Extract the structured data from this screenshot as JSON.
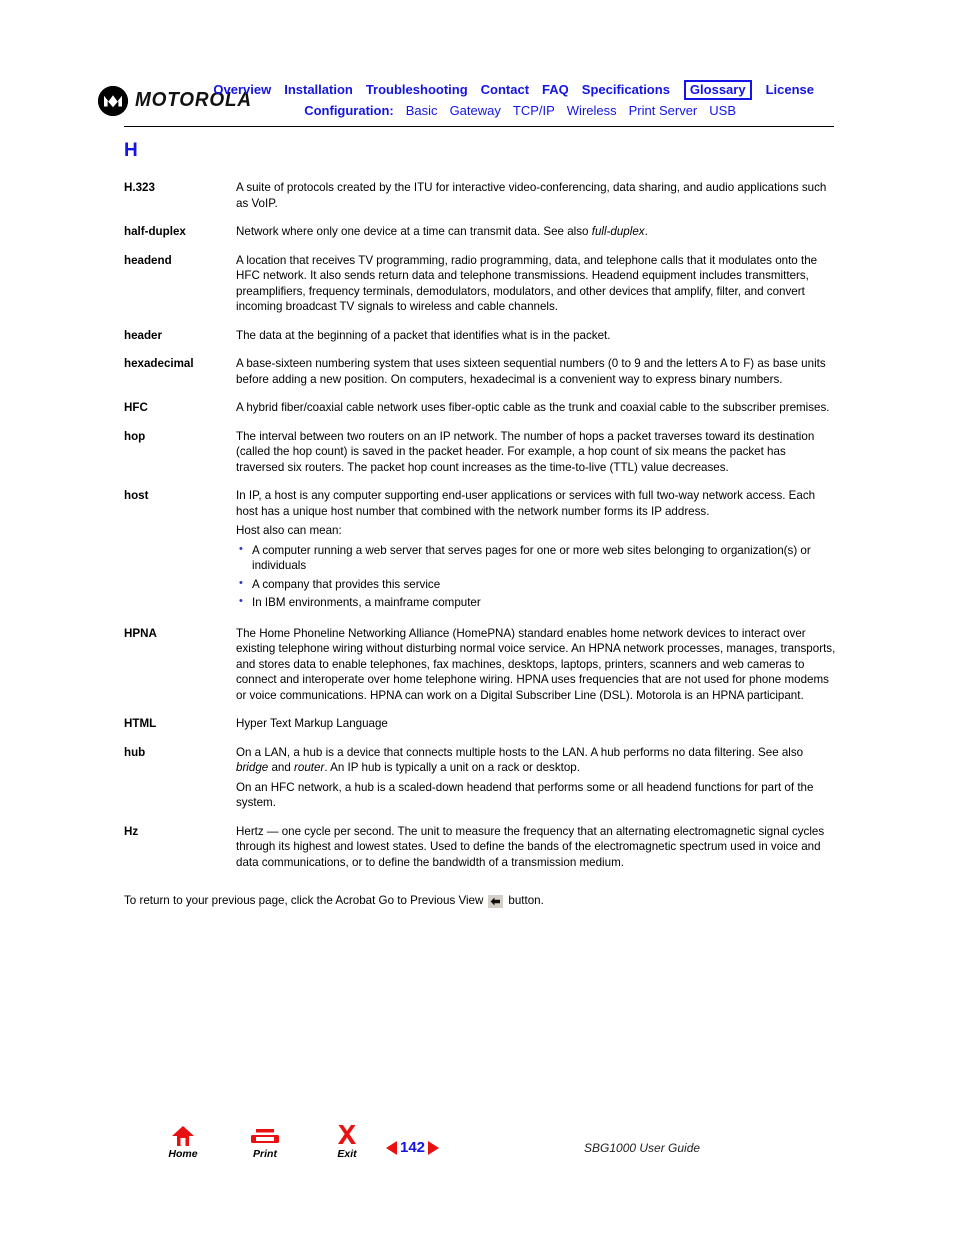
{
  "header": {
    "brand": "MOTOROLA",
    "brand_logo_icon": "motorola-batwing-icon",
    "nav_primary": [
      {
        "label": "Overview",
        "boxed": false
      },
      {
        "label": "Installation",
        "boxed": false
      },
      {
        "label": "Troubleshooting",
        "boxed": false
      },
      {
        "label": "Contact",
        "boxed": false
      },
      {
        "label": "FAQ",
        "boxed": false
      },
      {
        "label": "Specifications",
        "boxed": false
      },
      {
        "label": "Glossary",
        "boxed": true
      },
      {
        "label": "License",
        "boxed": false
      }
    ],
    "nav_secondary_label": "Configuration:",
    "nav_secondary": [
      {
        "label": "Basic"
      },
      {
        "label": "Gateway"
      },
      {
        "label": "TCP/IP"
      },
      {
        "label": "Wireless"
      },
      {
        "label": "Print Server"
      },
      {
        "label": "USB"
      }
    ],
    "link_color": "#1414e6"
  },
  "main": {
    "letter_heading": "H",
    "entries": [
      {
        "term": "H.323",
        "paragraphs": [
          "A suite of protocols created by the ITU for interactive video-conferencing, data sharing, and audio applications such as VoIP."
        ]
      },
      {
        "term": "half-duplex",
        "paragraphs": [
          "Network where only one device at a time can transmit data. See also "
        ],
        "italic_tail": "full-duplex",
        "tail_after": "."
      },
      {
        "term": "headend",
        "paragraphs": [
          "A location that receives TV programming, radio programming, data, and telephone calls that it modulates onto the HFC network. It also sends return data and telephone transmissions. Headend equipment includes transmitters, preamplifiers, frequency terminals, demodulators, modulators, and other devices that amplify, filter, and convert incoming broadcast TV signals to wireless and cable channels."
        ]
      },
      {
        "term": "header",
        "paragraphs": [
          "The data at the beginning of a packet that identifies what is in the packet."
        ]
      },
      {
        "term": "hexadecimal",
        "paragraphs": [
          "A base-sixteen numbering system that uses sixteen sequential numbers (0 to 9 and the letters A to F) as base units before adding a new position. On computers, hexadecimal is a convenient way to express binary numbers."
        ]
      },
      {
        "term": "HFC",
        "paragraphs": [
          "A hybrid fiber/coaxial cable network uses fiber-optic cable as the trunk and coaxial cable to the subscriber premises."
        ]
      },
      {
        "term": "hop",
        "paragraphs": [
          "The interval between two routers on an IP network. The number of hops a packet traverses toward its destination (called the hop count) is saved in the packet header. For example, a hop count of six means the packet has traversed six routers. The packet hop count increases as the time-to-live (TTL) value decreases."
        ]
      },
      {
        "term": "host",
        "paragraphs": [
          "In IP, a host is any computer supporting end-user applications or services with full two-way network access. Each host has a unique host number that combined with the network number forms its IP address.",
          "Host also can mean:"
        ],
        "bullets": [
          "A computer running a web server that serves pages for one or more web sites belonging to organization(s) or individuals",
          "A company that provides this service",
          "In IBM environments, a mainframe computer"
        ]
      },
      {
        "term": "HPNA",
        "paragraphs": [
          "The Home Phoneline Networking Alliance (HomePNA) standard enables home network devices to interact over existing telephone wiring without disturbing normal voice service. An HPNA network processes, manages, transports, and stores data to enable telephones, fax machines, desktops, laptops, printers, scanners and web cameras to connect and interoperate over home telephone wiring. HPNA uses frequencies that are not used for phone modems or voice communications. HPNA can work on a Digital Subscriber Line (DSL). Motorola is an HPNA participant."
        ]
      },
      {
        "term": "HTML",
        "paragraphs": [
          "Hyper Text Markup Language"
        ]
      },
      {
        "term": "hub",
        "paragraphs": [
          "On a LAN, a hub is a device that connects multiple hosts to the LAN. A hub performs no data filtering. See also ",
          "On an HFC network, a hub is a scaled-down headend that performs some or all headend functions for part of the system."
        ],
        "inline_italic_1": "bridge",
        "inline_mid": " and ",
        "inline_italic_2": "router",
        "inline_tail": ". An IP hub is typically a unit on a rack or desktop."
      },
      {
        "term": "Hz",
        "paragraphs": [
          "Hertz — one cycle per second. The unit to measure the frequency that an alternating electromagnetic signal cycles through its highest and lowest states. Used to define the bands of the electromagnetic spectrum used in voice and data communications, or to define the bandwidth of a transmission medium."
        ]
      }
    ],
    "return_note_before": "To return to your previous page, click the Acrobat Go to Previous View",
    "return_note_after": "button.",
    "return_note_icon": "go-to-previous-view-icon"
  },
  "footer": {
    "icons": [
      {
        "label": "Home",
        "icon": "home-icon"
      },
      {
        "label": "Print",
        "icon": "printer-icon"
      },
      {
        "label": "Exit",
        "icon": "exit-x-icon"
      }
    ],
    "page_number": "142",
    "prev_icon": "previous-page-arrow-icon",
    "next_icon": "next-page-arrow-icon",
    "guide_title": "SBG1000 User Guide",
    "accent_red": "#e81010",
    "accent_blue": "#1414e6"
  }
}
